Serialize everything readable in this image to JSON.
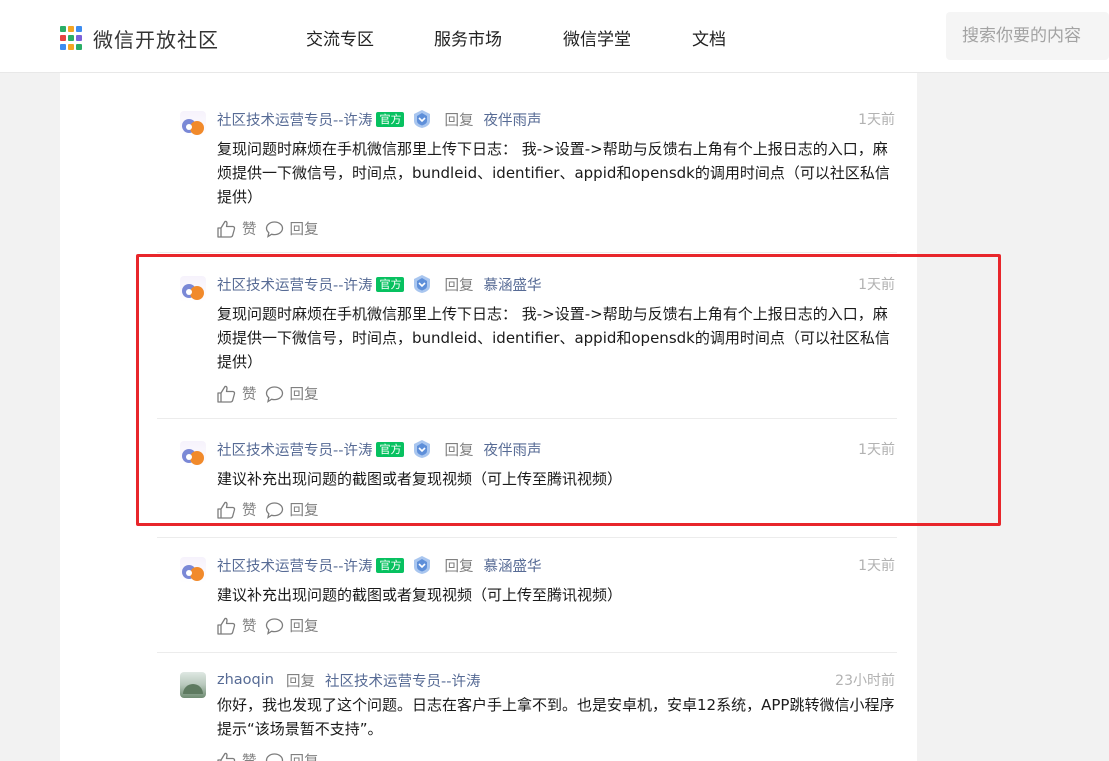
{
  "header": {
    "logo_text": "微信开放社区",
    "nav": [
      "交流专区",
      "服务市场",
      "微信学堂",
      "文档"
    ],
    "search_placeholder": "搜索你要的内容"
  },
  "colors": {
    "author_link": "#576b95",
    "official_tag": "#07c160",
    "highlight_border": "#e8262b"
  },
  "comments": [
    {
      "author": "社区技术运营专员--许涛",
      "tag": "官方",
      "reply_label": "回复",
      "reply_to": "夜伴雨声",
      "time": "1天前",
      "text": "复现问题时麻烦在手机微信那里上传下日志： 我->设置->帮助与反馈右上角有个上报日志的入口，麻烦提供一下微信号，时间点，bundleid、identifier、appid和opensdk的调用时间点（可以社区私信提供）",
      "like_label": "赞",
      "reply_action": "回复"
    },
    {
      "author": "社区技术运营专员--许涛",
      "tag": "官方",
      "reply_label": "回复",
      "reply_to": "慕涵盛华",
      "time": "1天前",
      "text": "复现问题时麻烦在手机微信那里上传下日志： 我->设置->帮助与反馈右上角有个上报日志的入口，麻烦提供一下微信号，时间点，bundleid、identifier、appid和opensdk的调用时间点（可以社区私信提供）",
      "like_label": "赞",
      "reply_action": "回复"
    },
    {
      "author": "社区技术运营专员--许涛",
      "tag": "官方",
      "reply_label": "回复",
      "reply_to": "夜伴雨声",
      "time": "1天前",
      "text": "建议补充出现问题的截图或者复现视频（可上传至腾讯视频）",
      "like_label": "赞",
      "reply_action": "回复"
    },
    {
      "author": "社区技术运营专员--许涛",
      "tag": "官方",
      "reply_label": "回复",
      "reply_to": "慕涵盛华",
      "time": "1天前",
      "text": "建议补充出现问题的截图或者复现视频（可上传至腾讯视频）",
      "like_label": "赞",
      "reply_action": "回复"
    },
    {
      "author": "zhaoqin",
      "tag": "",
      "reply_label": "回复",
      "reply_to": "社区技术运营专员--许涛",
      "time": "23小时前",
      "text": "你好，我也发现了这个问题。日志在客户手上拿不到。也是安卓机，安卓12系统，APP跳转微信小程序提示“该场景暂不支持”。",
      "like_label": "赞",
      "reply_action": "回复"
    }
  ]
}
